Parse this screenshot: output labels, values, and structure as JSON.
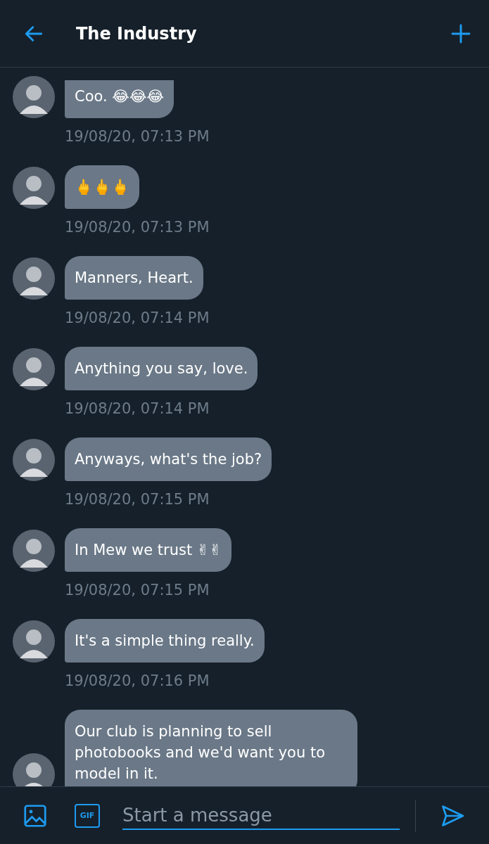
{
  "header": {
    "title": "The Industry"
  },
  "messages": [
    {
      "text": "Coo. 😂😂😂",
      "time": "19/08/20, 07:13 PM",
      "cut_top": true
    },
    {
      "text": "🖕🖕🖕",
      "time": "19/08/20, 07:13 PM",
      "cut_top": false
    },
    {
      "text": "Manners, Heart.",
      "time": "19/08/20, 07:14 PM",
      "cut_top": false
    },
    {
      "text": "Anything you say, love.",
      "time": "19/08/20, 07:14 PM",
      "cut_top": false
    },
    {
      "text": "Anyways, what's the job?",
      "time": "19/08/20, 07:15 PM",
      "cut_top": false
    },
    {
      "text": "In Mew we trust ✌✌",
      "time": "19/08/20, 07:15 PM",
      "cut_top": false
    },
    {
      "text": "It's a simple thing really.",
      "time": "19/08/20, 07:16 PM",
      "cut_top": false
    },
    {
      "text": "Our club is planning to sell photobooks and we'd want you to model in it.",
      "cut_top": false
    }
  ],
  "composer": {
    "gif_label": "GIF",
    "placeholder": "Start a message"
  }
}
